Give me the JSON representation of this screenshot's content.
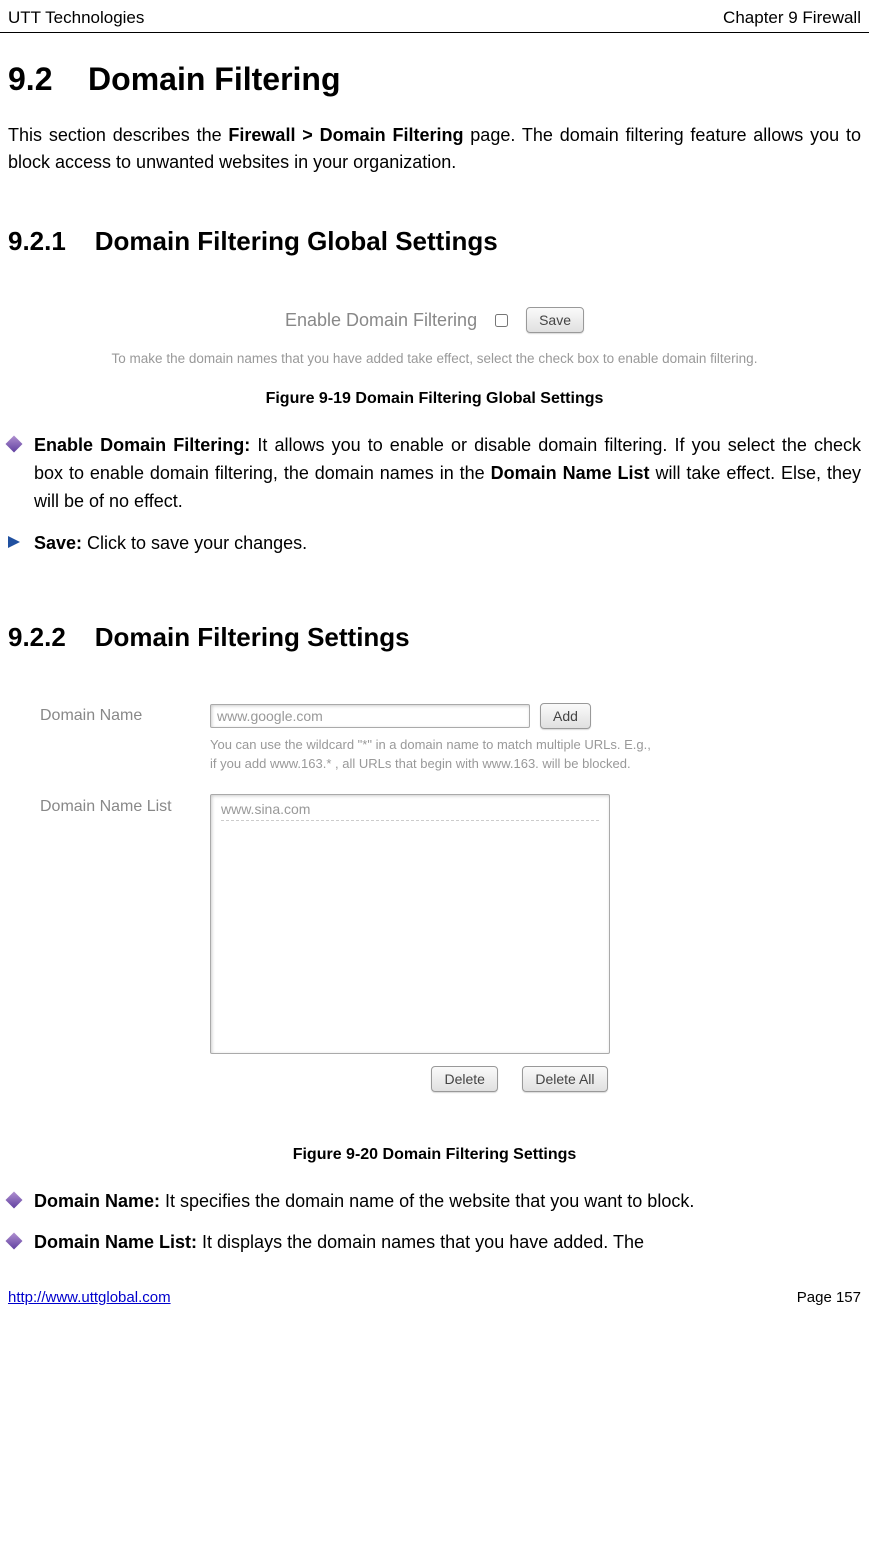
{
  "header": {
    "left": "UTT Technologies",
    "right": "Chapter 9 Firewall"
  },
  "section": {
    "number": "9.2",
    "title": "Domain Filtering"
  },
  "intro": {
    "part1": "This section describes the ",
    "bold": "Firewall > Domain Filtering",
    "part2": " page. The domain filtering feature allows you to block access to unwanted websites in your organization."
  },
  "sub1": {
    "number": "9.2.1",
    "title": "Domain Filtering Global Settings"
  },
  "fig1": {
    "enable_label": "Enable Domain Filtering",
    "save_btn": "Save",
    "hint": "To make the domain names that you have added take effect, select the check box to enable domain filtering.",
    "caption": "Figure 9-19 Domain Filtering Global Settings"
  },
  "bullets1": [
    {
      "bold": "Enable Domain Filtering:",
      "text": " It allows you to enable or disable domain filtering. If you select the check box to enable domain filtering, the domain names in the ",
      "bold2": "Domain Name List",
      "text2": " will take effect. Else, they will be of no effect."
    },
    {
      "bold": "Save:",
      "text": " Click to save your changes."
    }
  ],
  "sub2": {
    "number": "9.2.2",
    "title": "Domain Filtering Settings"
  },
  "fig2": {
    "domain_label": "Domain Name",
    "domain_value": "www.google.com",
    "add_btn": "Add",
    "wildcard_hint1": "You can use the wildcard \"*\" in a domain name to match multiple URLs. E.g.,",
    "wildcard_hint2": "if you add www.163.* , all URLs that begin with www.163. will be blocked.",
    "list_label": "Domain Name List",
    "list_item": "www.sina.com",
    "delete_btn": "Delete",
    "delete_all_btn": "Delete All",
    "caption": "Figure 9-20 Domain Filtering Settings"
  },
  "bullets2": [
    {
      "bold": "Domain Name:",
      "text": " It specifies the domain name of the website that you want to block."
    },
    {
      "bold": "Domain Name List:",
      "text": " It displays the domain names that you have added. The"
    }
  ],
  "footer": {
    "url": "http://www.uttglobal.com",
    "page": "Page 157"
  }
}
